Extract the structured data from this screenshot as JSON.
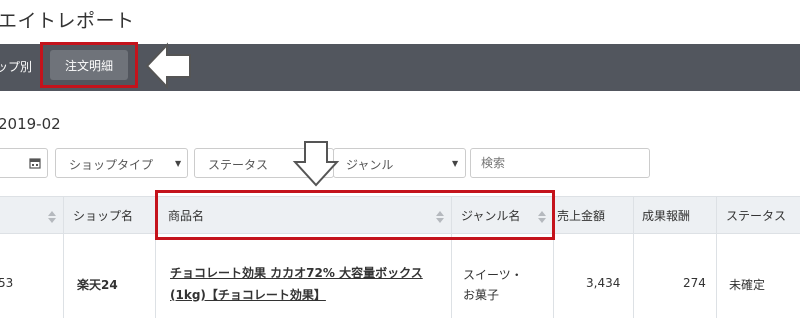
{
  "header": {
    "title": "エイトレポート"
  },
  "nav": {
    "shop_tab": "ップ別",
    "order_detail_button": "注文明細"
  },
  "period": {
    "label": "2019-02"
  },
  "filters": {
    "shop_type": "ショップタイプ",
    "status": "ステータス",
    "genre": "ジャンル",
    "search_placeholder": "検索"
  },
  "table": {
    "headers": [
      "ショップ名",
      "商品名",
      "ジャンル名",
      "売上金額",
      "成果報酬",
      "ステータス"
    ],
    "rows": [
      {
        "id": "53",
        "shop": "楽天24",
        "product_line1": "チョコレート効果 カカオ72% 大容量ボックス",
        "product_line2": "(1kg)【チョコレート効果】",
        "genre_line1": "スイーツ・",
        "genre_line2": "お菓子",
        "sales": "3,434",
        "reward": "274",
        "status": "未確定"
      }
    ]
  },
  "colors": {
    "nav_bg": "#52565e",
    "highlight_red": "#c4131c",
    "header_bg": "#edf0f3"
  }
}
